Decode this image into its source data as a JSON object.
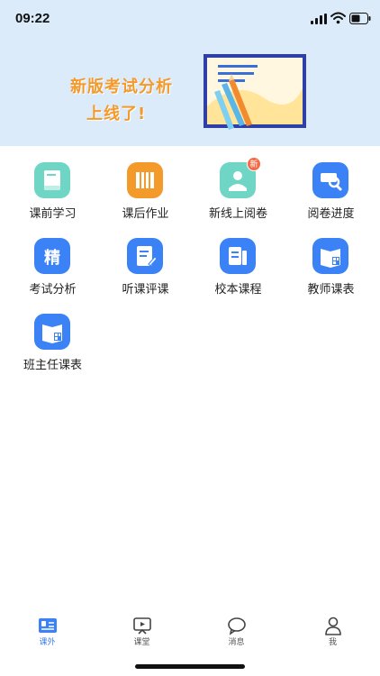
{
  "status_bar": {
    "time": "09:22"
  },
  "banner": {
    "line1": "新版考试分析",
    "line2": "上线了!"
  },
  "colors": {
    "accent": "#3b82f6",
    "teal": "#6fd6c6",
    "orange": "#f39a2b",
    "badge": "#f36a45"
  },
  "grid": [
    {
      "label": "课前学习",
      "icon": "book-icon",
      "color": "#6fd6c6"
    },
    {
      "label": "课后作业",
      "icon": "books-icon",
      "color": "#f39a2b"
    },
    {
      "label": "新线上阅卷",
      "icon": "reader-icon",
      "color": "#6fd6c6",
      "badge": "新"
    },
    {
      "label": "阅卷进度",
      "icon": "search-progress-icon",
      "color": "#3b82f6"
    },
    {
      "label": "考试分析",
      "icon": "jing-icon",
      "color": "#3b82f6",
      "glyph": "精"
    },
    {
      "label": "听课评课",
      "icon": "edit-doc-icon",
      "color": "#3b82f6"
    },
    {
      "label": "校本课程",
      "icon": "course-icon",
      "color": "#3b82f6"
    },
    {
      "label": "教师课表",
      "icon": "timetable-icon",
      "color": "#3b82f6"
    },
    {
      "label": "班主任课表",
      "icon": "timetable-icon",
      "color": "#3b82f6"
    }
  ],
  "tabs": [
    {
      "label": "课外",
      "icon": "outside-class-icon",
      "active": true
    },
    {
      "label": "课堂",
      "icon": "classroom-icon",
      "active": false
    },
    {
      "label": "消息",
      "icon": "message-icon",
      "active": false
    },
    {
      "label": "我",
      "icon": "profile-icon",
      "active": false
    }
  ]
}
